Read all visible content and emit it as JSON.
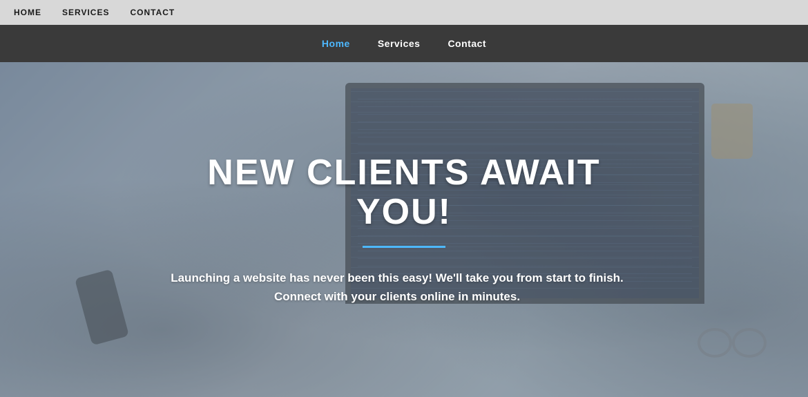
{
  "topNav": {
    "items": [
      {
        "label": "HOME",
        "id": "home"
      },
      {
        "label": "SERVICES",
        "id": "services"
      },
      {
        "label": "CONTACT",
        "id": "contact"
      }
    ]
  },
  "secondaryNav": {
    "items": [
      {
        "label": "Home",
        "id": "home",
        "active": true
      },
      {
        "label": "Services",
        "id": "services",
        "active": false
      },
      {
        "label": "Contact",
        "id": "contact",
        "active": false
      }
    ]
  },
  "hero": {
    "title": "NEW CLIENTS AWAIT YOU!",
    "subtitle": "Launching a website has never been this easy! We'll take you from start to finish. Connect with your clients online in minutes.",
    "divider_color": "#4db8ff"
  },
  "colors": {
    "topNavBg": "#d8d8d8",
    "secondaryNavBg": "#3a3a3a",
    "activeLink": "#4db8ff",
    "heroOverlay": "rgba(100, 115, 130, 0.45)"
  }
}
